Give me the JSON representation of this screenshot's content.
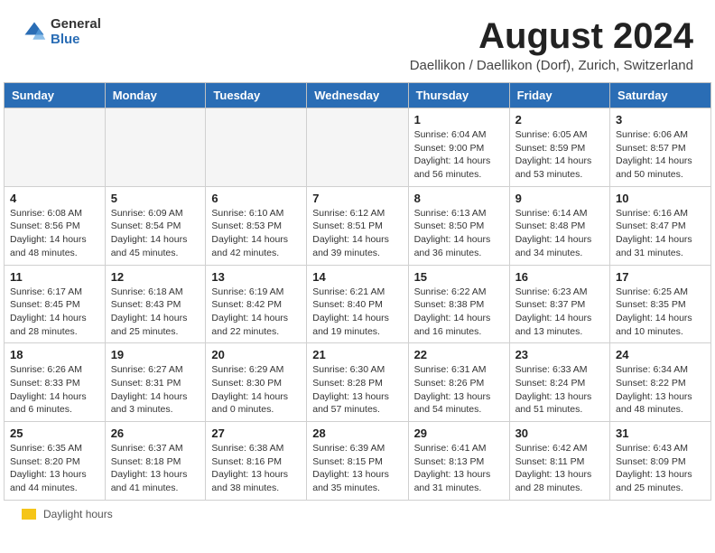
{
  "header": {
    "logo_general": "General",
    "logo_blue": "Blue",
    "month_title": "August 2024",
    "subtitle": "Daellikon / Daellikon (Dorf), Zurich, Switzerland"
  },
  "days_of_week": [
    "Sunday",
    "Monday",
    "Tuesday",
    "Wednesday",
    "Thursday",
    "Friday",
    "Saturday"
  ],
  "weeks": [
    [
      {
        "day": "",
        "info": ""
      },
      {
        "day": "",
        "info": ""
      },
      {
        "day": "",
        "info": ""
      },
      {
        "day": "",
        "info": ""
      },
      {
        "day": "1",
        "info": "Sunrise: 6:04 AM\nSunset: 9:00 PM\nDaylight: 14 hours and 56 minutes."
      },
      {
        "day": "2",
        "info": "Sunrise: 6:05 AM\nSunset: 8:59 PM\nDaylight: 14 hours and 53 minutes."
      },
      {
        "day": "3",
        "info": "Sunrise: 6:06 AM\nSunset: 8:57 PM\nDaylight: 14 hours and 50 minutes."
      }
    ],
    [
      {
        "day": "4",
        "info": "Sunrise: 6:08 AM\nSunset: 8:56 PM\nDaylight: 14 hours and 48 minutes."
      },
      {
        "day": "5",
        "info": "Sunrise: 6:09 AM\nSunset: 8:54 PM\nDaylight: 14 hours and 45 minutes."
      },
      {
        "day": "6",
        "info": "Sunrise: 6:10 AM\nSunset: 8:53 PM\nDaylight: 14 hours and 42 minutes."
      },
      {
        "day": "7",
        "info": "Sunrise: 6:12 AM\nSunset: 8:51 PM\nDaylight: 14 hours and 39 minutes."
      },
      {
        "day": "8",
        "info": "Sunrise: 6:13 AM\nSunset: 8:50 PM\nDaylight: 14 hours and 36 minutes."
      },
      {
        "day": "9",
        "info": "Sunrise: 6:14 AM\nSunset: 8:48 PM\nDaylight: 14 hours and 34 minutes."
      },
      {
        "day": "10",
        "info": "Sunrise: 6:16 AM\nSunset: 8:47 PM\nDaylight: 14 hours and 31 minutes."
      }
    ],
    [
      {
        "day": "11",
        "info": "Sunrise: 6:17 AM\nSunset: 8:45 PM\nDaylight: 14 hours and 28 minutes."
      },
      {
        "day": "12",
        "info": "Sunrise: 6:18 AM\nSunset: 8:43 PM\nDaylight: 14 hours and 25 minutes."
      },
      {
        "day": "13",
        "info": "Sunrise: 6:19 AM\nSunset: 8:42 PM\nDaylight: 14 hours and 22 minutes."
      },
      {
        "day": "14",
        "info": "Sunrise: 6:21 AM\nSunset: 8:40 PM\nDaylight: 14 hours and 19 minutes."
      },
      {
        "day": "15",
        "info": "Sunrise: 6:22 AM\nSunset: 8:38 PM\nDaylight: 14 hours and 16 minutes."
      },
      {
        "day": "16",
        "info": "Sunrise: 6:23 AM\nSunset: 8:37 PM\nDaylight: 14 hours and 13 minutes."
      },
      {
        "day": "17",
        "info": "Sunrise: 6:25 AM\nSunset: 8:35 PM\nDaylight: 14 hours and 10 minutes."
      }
    ],
    [
      {
        "day": "18",
        "info": "Sunrise: 6:26 AM\nSunset: 8:33 PM\nDaylight: 14 hours and 6 minutes."
      },
      {
        "day": "19",
        "info": "Sunrise: 6:27 AM\nSunset: 8:31 PM\nDaylight: 14 hours and 3 minutes."
      },
      {
        "day": "20",
        "info": "Sunrise: 6:29 AM\nSunset: 8:30 PM\nDaylight: 14 hours and 0 minutes."
      },
      {
        "day": "21",
        "info": "Sunrise: 6:30 AM\nSunset: 8:28 PM\nDaylight: 13 hours and 57 minutes."
      },
      {
        "day": "22",
        "info": "Sunrise: 6:31 AM\nSunset: 8:26 PM\nDaylight: 13 hours and 54 minutes."
      },
      {
        "day": "23",
        "info": "Sunrise: 6:33 AM\nSunset: 8:24 PM\nDaylight: 13 hours and 51 minutes."
      },
      {
        "day": "24",
        "info": "Sunrise: 6:34 AM\nSunset: 8:22 PM\nDaylight: 13 hours and 48 minutes."
      }
    ],
    [
      {
        "day": "25",
        "info": "Sunrise: 6:35 AM\nSunset: 8:20 PM\nDaylight: 13 hours and 44 minutes."
      },
      {
        "day": "26",
        "info": "Sunrise: 6:37 AM\nSunset: 8:18 PM\nDaylight: 13 hours and 41 minutes."
      },
      {
        "day": "27",
        "info": "Sunrise: 6:38 AM\nSunset: 8:16 PM\nDaylight: 13 hours and 38 minutes."
      },
      {
        "day": "28",
        "info": "Sunrise: 6:39 AM\nSunset: 8:15 PM\nDaylight: 13 hours and 35 minutes."
      },
      {
        "day": "29",
        "info": "Sunrise: 6:41 AM\nSunset: 8:13 PM\nDaylight: 13 hours and 31 minutes."
      },
      {
        "day": "30",
        "info": "Sunrise: 6:42 AM\nSunset: 8:11 PM\nDaylight: 13 hours and 28 minutes."
      },
      {
        "day": "31",
        "info": "Sunrise: 6:43 AM\nSunset: 8:09 PM\nDaylight: 13 hours and 25 minutes."
      }
    ]
  ],
  "footer": {
    "daylight_label": "Daylight hours"
  },
  "colors": {
    "header_bg": "#2a6db5",
    "logo_blue": "#2a6db5"
  }
}
